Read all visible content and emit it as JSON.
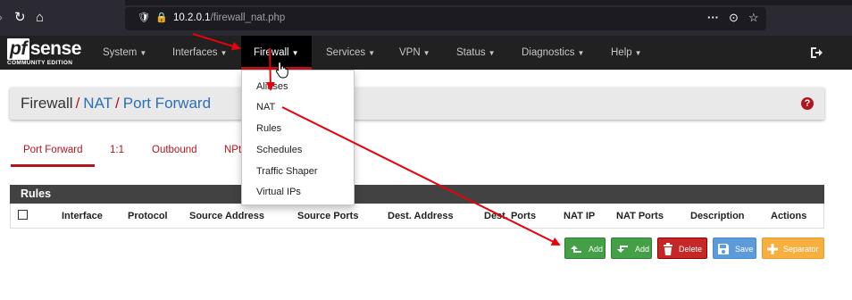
{
  "browser": {
    "url_host": "10.2.0.1",
    "url_path": "/firewall_nat.php",
    "menu_dots": "···"
  },
  "brand": {
    "logo_pf": "pf",
    "logo_sense": "sense",
    "edition": "COMMUNITY EDITION"
  },
  "nav": {
    "items": [
      {
        "label": "System"
      },
      {
        "label": "Interfaces"
      },
      {
        "label": "Firewall"
      },
      {
        "label": "Services"
      },
      {
        "label": "VPN"
      },
      {
        "label": "Status"
      },
      {
        "label": "Diagnostics"
      },
      {
        "label": "Help"
      }
    ]
  },
  "firewall_menu": {
    "items": [
      {
        "label": "Aliases"
      },
      {
        "label": "NAT"
      },
      {
        "label": "Rules"
      },
      {
        "label": "Schedules"
      },
      {
        "label": "Traffic Shaper"
      },
      {
        "label": "Virtual IPs"
      }
    ]
  },
  "breadcrumb": {
    "items": [
      "Firewall",
      "NAT",
      "Port Forward"
    ],
    "separator": "/"
  },
  "help_label": "?",
  "tabs": [
    {
      "label": "Port Forward",
      "active": true
    },
    {
      "label": "1:1"
    },
    {
      "label": "Outbound"
    },
    {
      "label": "NPt"
    }
  ],
  "rules": {
    "title": "Rules",
    "columns": [
      "Interface",
      "Protocol",
      "Source Address",
      "Source Ports",
      "Dest. Address",
      "Dest. Ports",
      "NAT IP",
      "NAT Ports",
      "Description",
      "Actions"
    ]
  },
  "buttons": {
    "add_top": "Add",
    "add_bottom": "Add",
    "delete": "Delete",
    "save": "Save",
    "separator": "Separator"
  },
  "colors": {
    "accent_red": "#b2141d",
    "navbar": "#212121",
    "link_blue": "#2c6fb4",
    "success_green": "#43a047",
    "danger_red": "#c62828",
    "info_blue": "#5c9bd9",
    "warning_orange": "#f7b040",
    "annotation_arrow": "#e8000b"
  }
}
